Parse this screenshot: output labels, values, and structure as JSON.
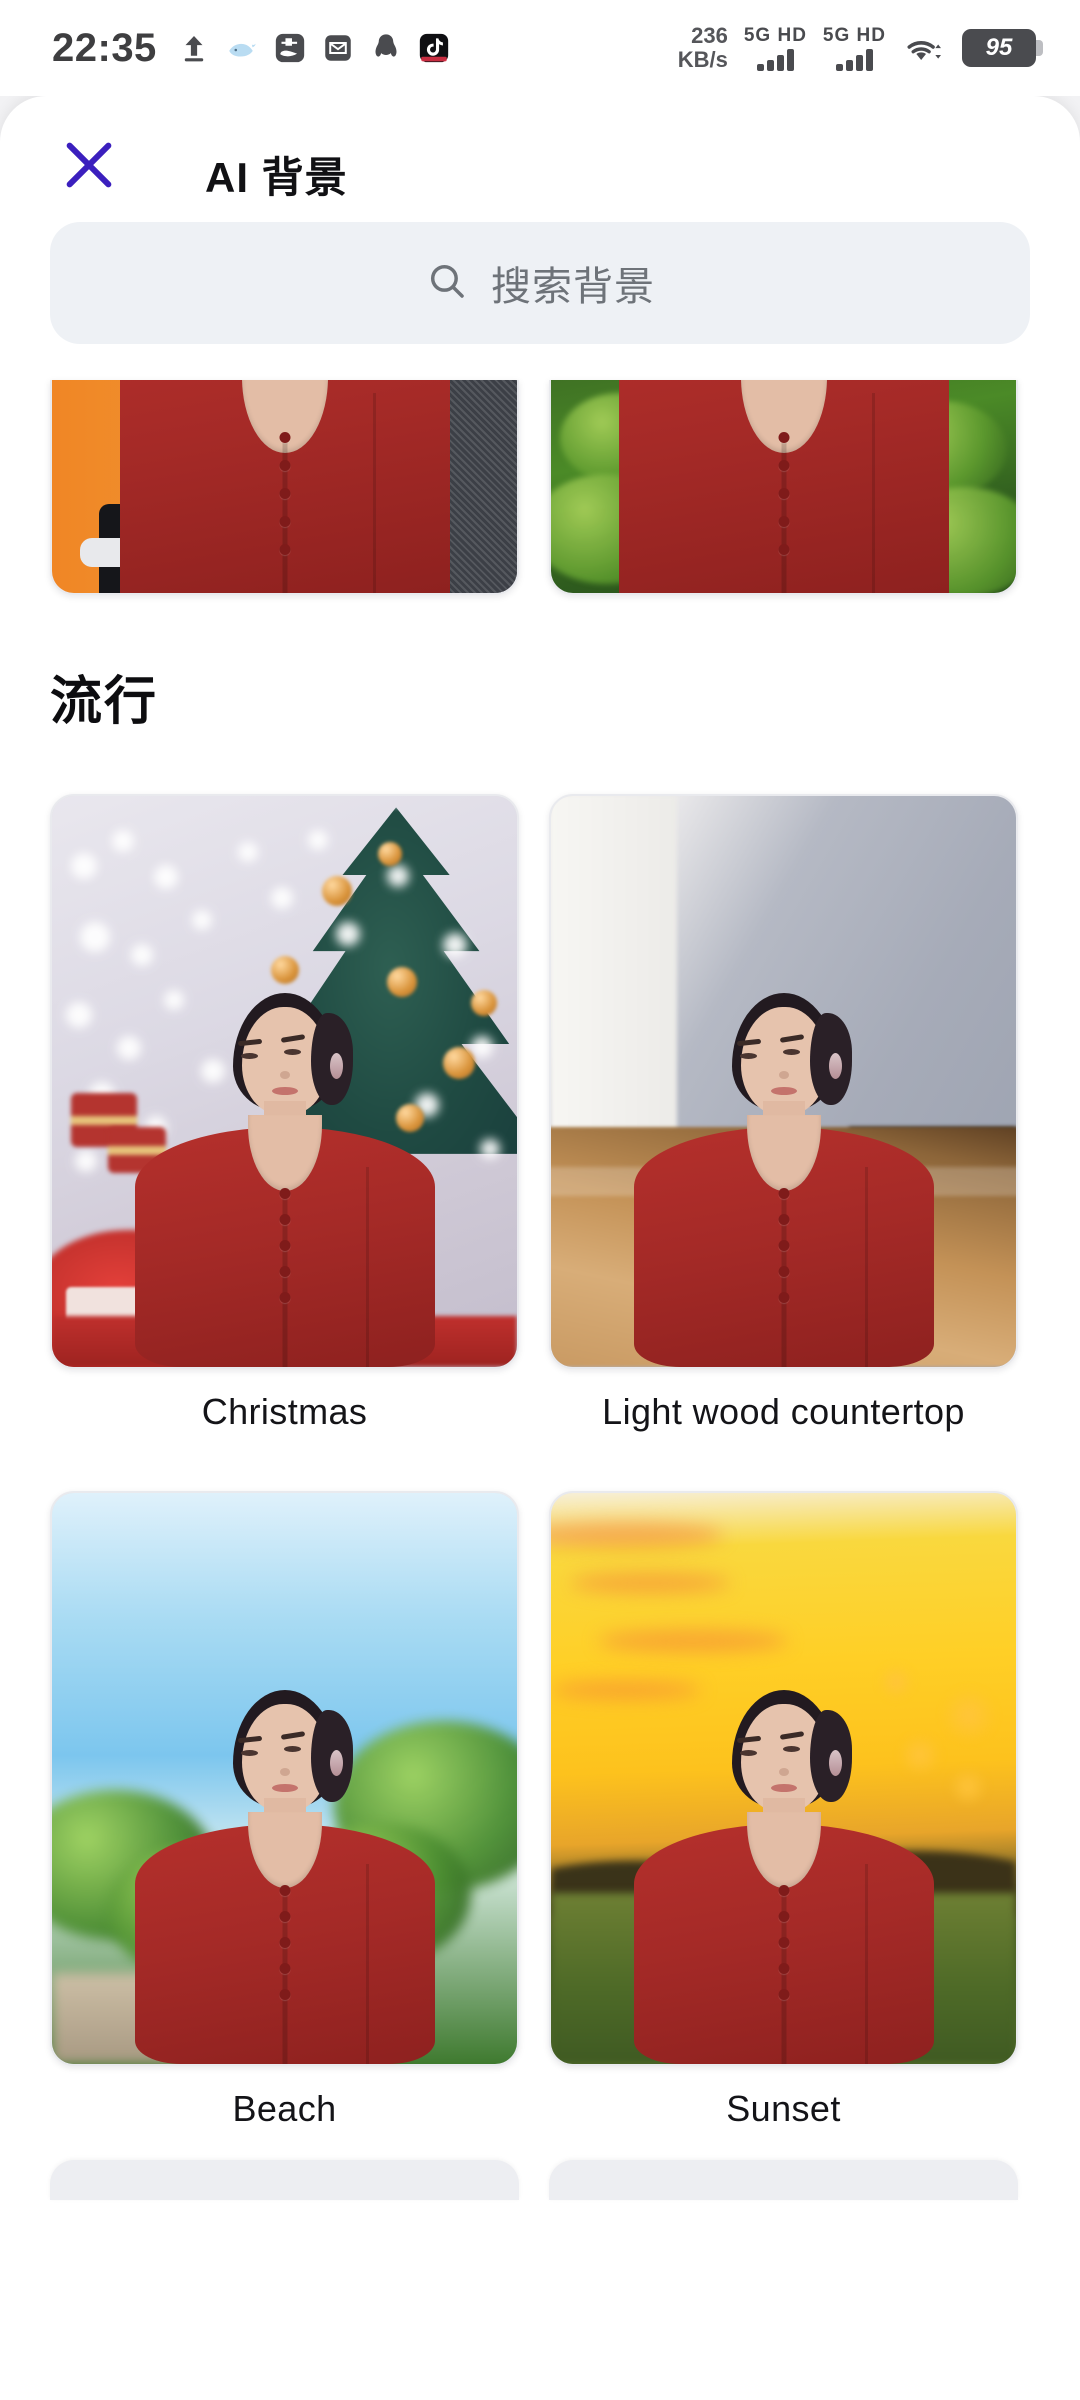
{
  "status_bar": {
    "time": "22:35",
    "left_icons": [
      "upload-icon",
      "whale-icon",
      "alipay-icon",
      "mail-icon",
      "qq-icon",
      "tiktok-icon"
    ],
    "network_speed_value": "236",
    "network_speed_unit": "KB/s",
    "sim1_tag": "5G HD",
    "sim2_tag": "5G HD",
    "wifi": "wifi-icon",
    "battery_percent": "95"
  },
  "header": {
    "close_label": "×",
    "title": "AI 背景",
    "accent_color": "#3B1FBE"
  },
  "search": {
    "placeholder": "搜索背景",
    "value": "",
    "icon": "search-icon",
    "background_color": "#EEF1F5"
  },
  "sections": [
    {
      "id": "scrolled-above",
      "title": "",
      "items": [
        {
          "label": "",
          "scene": "office"
        },
        {
          "label": "",
          "scene": "garden"
        }
      ]
    },
    {
      "id": "popular",
      "title": "流行",
      "items": [
        {
          "label": "Christmas",
          "scene": "xmas"
        },
        {
          "label": "Light wood countertop",
          "scene": "wood"
        },
        {
          "label": "Beach",
          "scene": "beach"
        },
        {
          "label": "Sunset",
          "scene": "sunset"
        }
      ]
    }
  ],
  "colors": {
    "page_background": "#FFFFFF",
    "text_primary": "#111114",
    "text_secondary": "#6E7379",
    "accent": "#3B1FBE",
    "shirt_red": "#A52A27"
  }
}
